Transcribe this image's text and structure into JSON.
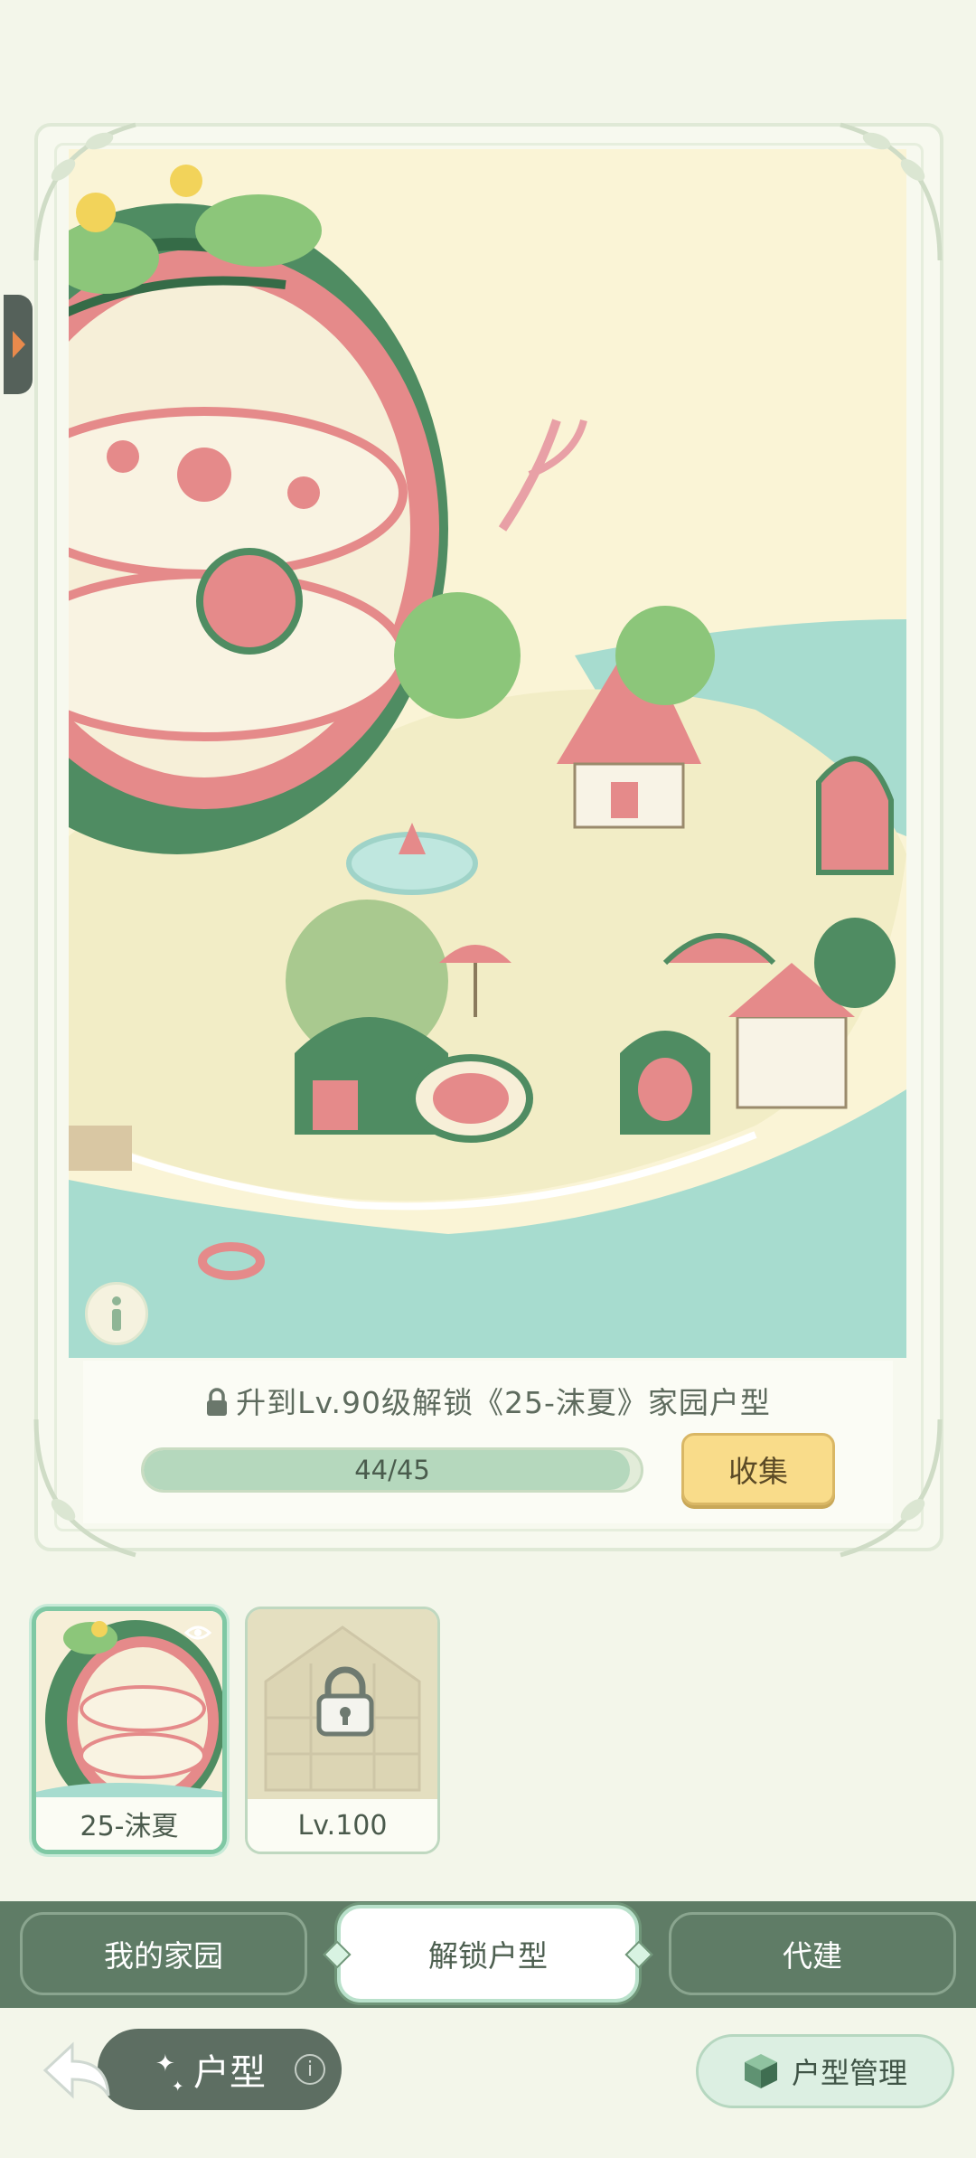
{
  "unlock": {
    "text": "升到Lv.90级解锁《25-沫夏》家园户型",
    "progress_text": "44/45",
    "progress_fraction": 0.978,
    "collect_label": "收集"
  },
  "thumbnails": [
    {
      "label": "25-沫夏",
      "selected": true,
      "locked": false
    },
    {
      "label": "Lv.100",
      "selected": false,
      "locked": true
    }
  ],
  "tabs": {
    "home": "我的家园",
    "unlock": "解锁户型",
    "build": "代建"
  },
  "footer": {
    "type_label": "户型",
    "info_glyph": "i",
    "manage_label": "户型管理"
  },
  "colors": {
    "background": "#f3f6ea",
    "tab_bar": "#5f7c66",
    "collect_button": "#f9dc8a",
    "progress_fill": "#b5d8bd",
    "watermelon_red": "#e58a8a",
    "watermelon_green": "#4f8c62",
    "sea": "#a7dccf"
  },
  "icons": {
    "lock": "lock-icon",
    "eye": "eye-icon",
    "info": "info-icon",
    "back": "back-arrow-icon",
    "cube": "cube-icon"
  }
}
